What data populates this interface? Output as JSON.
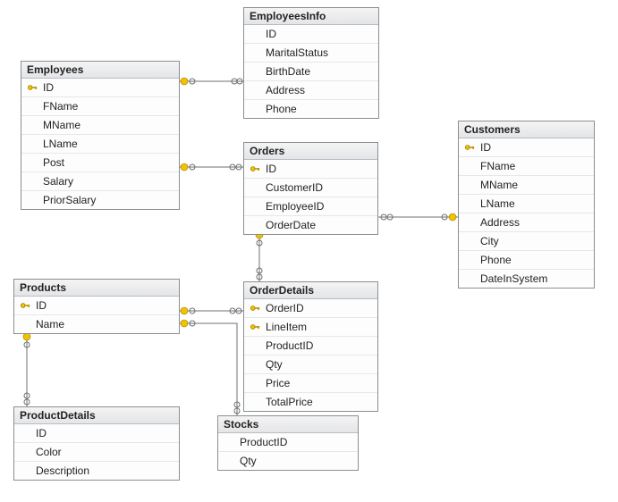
{
  "entities": {
    "employees": {
      "title": "Employees",
      "fields": [
        {
          "name": "ID",
          "pk": true
        },
        {
          "name": "FName",
          "pk": false
        },
        {
          "name": "MName",
          "pk": false
        },
        {
          "name": "LName",
          "pk": false
        },
        {
          "name": "Post",
          "pk": false
        },
        {
          "name": "Salary",
          "pk": false
        },
        {
          "name": "PriorSalary",
          "pk": false
        }
      ]
    },
    "employeesinfo": {
      "title": "EmployeesInfo",
      "fields": [
        {
          "name": "ID",
          "pk": false
        },
        {
          "name": "MaritalStatus",
          "pk": false
        },
        {
          "name": "BirthDate",
          "pk": false
        },
        {
          "name": "Address",
          "pk": false
        },
        {
          "name": "Phone",
          "pk": false
        }
      ]
    },
    "customers": {
      "title": "Customers",
      "fields": [
        {
          "name": "ID",
          "pk": true
        },
        {
          "name": "FName",
          "pk": false
        },
        {
          "name": "MName",
          "pk": false
        },
        {
          "name": "LName",
          "pk": false
        },
        {
          "name": "Address",
          "pk": false
        },
        {
          "name": "City",
          "pk": false
        },
        {
          "name": "Phone",
          "pk": false
        },
        {
          "name": "DateInSystem",
          "pk": false
        }
      ]
    },
    "orders": {
      "title": "Orders",
      "fields": [
        {
          "name": "ID",
          "pk": true
        },
        {
          "name": "CustomerID",
          "pk": false
        },
        {
          "name": "EmployeeID",
          "pk": false
        },
        {
          "name": "OrderDate",
          "pk": false
        }
      ]
    },
    "products": {
      "title": "Products",
      "fields": [
        {
          "name": "ID",
          "pk": true
        },
        {
          "name": "Name",
          "pk": false
        }
      ]
    },
    "orderdetails": {
      "title": "OrderDetails",
      "fields": [
        {
          "name": "OrderID",
          "pk": true
        },
        {
          "name": "LineItem",
          "pk": true
        },
        {
          "name": "ProductID",
          "pk": false
        },
        {
          "name": "Qty",
          "pk": false
        },
        {
          "name": "Price",
          "pk": false
        },
        {
          "name": "TotalPrice",
          "pk": false
        }
      ]
    },
    "productdetails": {
      "title": "ProductDetails",
      "fields": [
        {
          "name": "ID",
          "pk": false
        },
        {
          "name": "Color",
          "pk": false
        },
        {
          "name": "Description",
          "pk": false
        }
      ]
    },
    "stocks": {
      "title": "Stocks",
      "fields": [
        {
          "name": "ProductID",
          "pk": false
        },
        {
          "name": "Qty",
          "pk": false
        }
      ]
    }
  },
  "relationships": [
    {
      "from": "employees",
      "to": "employeesinfo",
      "type": "one-to-one"
    },
    {
      "from": "employees",
      "to": "orders",
      "type": "one-to-many"
    },
    {
      "from": "customers",
      "to": "orders",
      "type": "one-to-many"
    },
    {
      "from": "orders",
      "to": "orderdetails",
      "type": "one-to-many"
    },
    {
      "from": "products",
      "to": "orderdetails",
      "type": "one-to-many"
    },
    {
      "from": "products",
      "to": "productdetails",
      "type": "one-to-one"
    },
    {
      "from": "products",
      "to": "stocks",
      "type": "one-to-one"
    }
  ]
}
